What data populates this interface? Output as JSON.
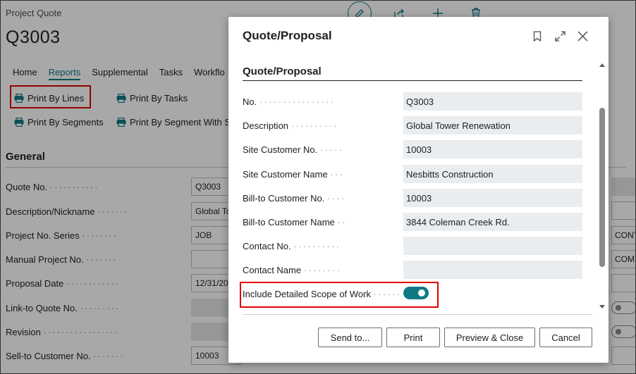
{
  "background": {
    "caption": "Project Quote",
    "title": "Q3003",
    "tabs": [
      {
        "label": "Home",
        "active": false
      },
      {
        "label": "Reports",
        "active": true
      },
      {
        "label": "Supplemental",
        "active": false
      },
      {
        "label": "Tasks",
        "active": false
      },
      {
        "label": "Workflo",
        "active": false
      }
    ],
    "reports": {
      "print_by_lines": "Print By Lines",
      "print_by_tasks": "Print By Tasks",
      "print_by_segments": "Print By Segments",
      "print_by_segment_with": "Print By Segment With SC"
    },
    "section_title": "General",
    "fields": [
      {
        "label": "Quote No.",
        "value": "Q3003"
      },
      {
        "label": "Description/Nickname",
        "value": "Global To"
      },
      {
        "label": "Project No. Series",
        "value": "JOB"
      },
      {
        "label": "Manual Project No.",
        "value": ""
      },
      {
        "label": "Proposal Date",
        "value": "12/31/20"
      },
      {
        "label": "Link-to Quote No.",
        "value": ""
      },
      {
        "label": "Revision",
        "value": ""
      },
      {
        "label": "Sell-to Customer No.",
        "value": "10003"
      }
    ],
    "right_values": [
      "CONT",
      "COM"
    ]
  },
  "dialog": {
    "title": "Quote/Proposal",
    "section_title": "Quote/Proposal",
    "fields": [
      {
        "label": "No.",
        "value": "Q3003"
      },
      {
        "label": "Description",
        "value": "Global Tower Renewation"
      },
      {
        "label": "Site Customer No.",
        "value": "10003"
      },
      {
        "label": "Site Customer Name",
        "value": "Nesbitts Construction"
      },
      {
        "label": "Bill-to Customer No.",
        "value": "10003"
      },
      {
        "label": "Bill-to Customer Name",
        "value": "3844 Coleman Creek Rd."
      },
      {
        "label": "Contact No.",
        "value": ""
      },
      {
        "label": "Contact Name",
        "value": ""
      }
    ],
    "toggle": {
      "label": "Include Detailed Scope of Work",
      "on": true
    },
    "buttons": {
      "send_to": "Send to...",
      "print": "Print",
      "preview_close": "Preview & Close",
      "cancel": "Cancel"
    }
  },
  "colors": {
    "accent": "#0f7a84",
    "highlight": "#e00000",
    "field_bg": "#eaedef"
  }
}
